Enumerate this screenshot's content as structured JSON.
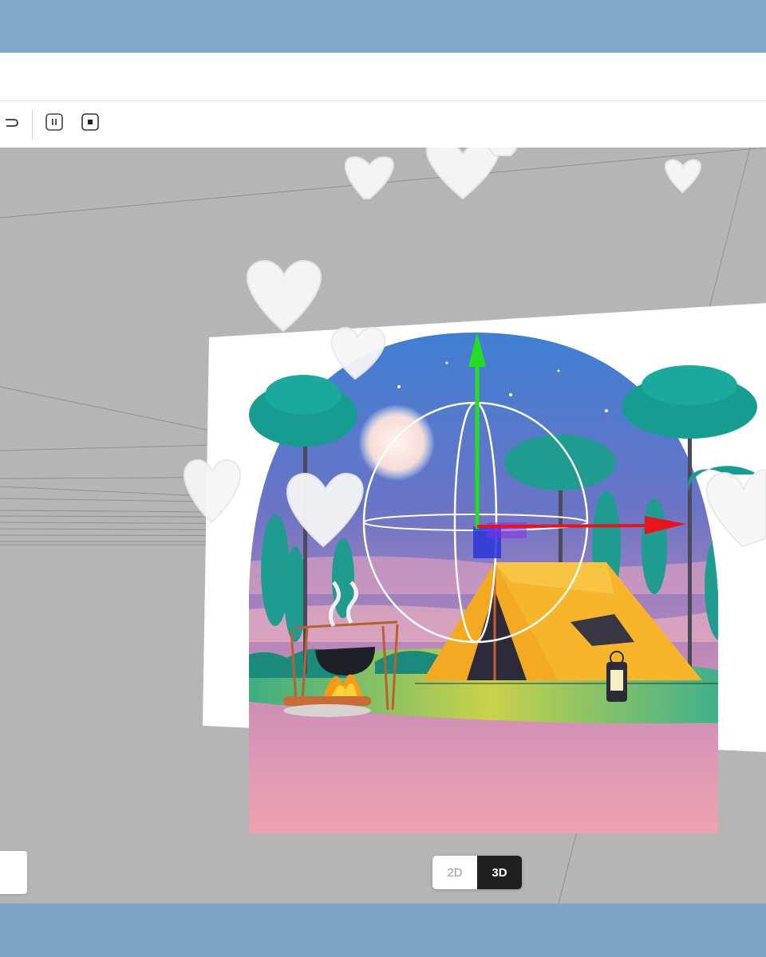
{
  "toolbar": {
    "redo_icon": "redo-icon",
    "pause_icon": "pause-icon",
    "stop_icon": "stop-icon"
  },
  "viewport": {
    "background": "#b5b5b5",
    "card_illustration": "camping-scene",
    "gizmo_colors": {
      "x_axis": "#e8141c",
      "y_axis": "#22dd22",
      "z_axis": "#2a35d8"
    }
  },
  "view_mode": {
    "label_2d": "2D",
    "label_3d": "3D",
    "active": "3D"
  }
}
